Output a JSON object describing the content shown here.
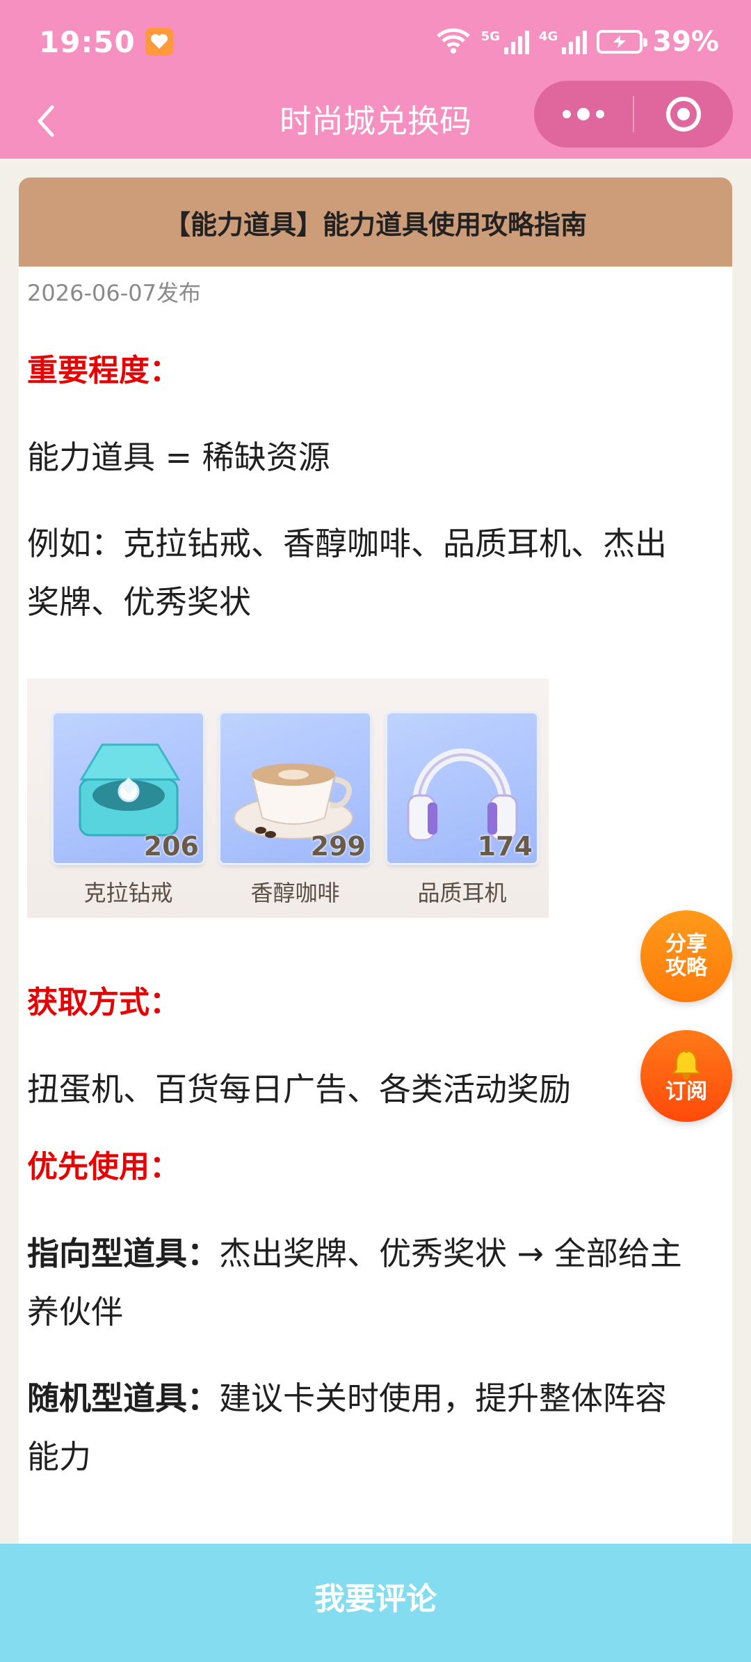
{
  "status_bar": {
    "time": "19:50",
    "network_5g": "5G",
    "network_4g": "4G",
    "wifi_label": "6",
    "battery_percent": "39%"
  },
  "nav": {
    "title": "时尚城兑换码",
    "back_icon": "chevron-left-icon",
    "more_icon": "more-dots-icon",
    "close_icon": "target-icon"
  },
  "article": {
    "title": "【能力道具】能力道具使用攻略指南",
    "date": "2026-06-07发布",
    "section1_heading": "重要程度：",
    "section1_line1": "能力道具 = 稀缺资源",
    "section1_line2": "例如：克拉钻戒、香醇咖啡、品质耳机、杰出奖牌、优秀奖状",
    "items": [
      {
        "name": "克拉钻戒",
        "count": "206",
        "icon": "diamond-ring-icon"
      },
      {
        "name": "香醇咖啡",
        "count": "299",
        "icon": "coffee-cup-icon"
      },
      {
        "name": "品质耳机",
        "count": "174",
        "icon": "headphones-icon"
      }
    ],
    "section2_heading": "获取方式：",
    "section2_line1": "扭蛋机、百货每日广告、各类活动奖励",
    "section3_heading": "优先使用：",
    "directed_label": "指向型道具：",
    "directed_text": "杰出奖牌、优秀奖状 → 全部给主养伙伴",
    "random_label": "随机型道具：",
    "random_text": "建议卡关时使用，提升整体阵容能力"
  },
  "floating": {
    "share_line1": "分享",
    "share_line2": "攻略",
    "subscribe_label": "订阅",
    "subscribe_icon": "bell-icon"
  },
  "bottom": {
    "comment_label": "我要评论"
  },
  "colors": {
    "header_bg": "#f590c0",
    "capsule_bg": "#e0679d",
    "card_header_bg": "#cd9c79",
    "heading_red": "#e60000",
    "bottom_bar_bg": "#84dcf0"
  }
}
